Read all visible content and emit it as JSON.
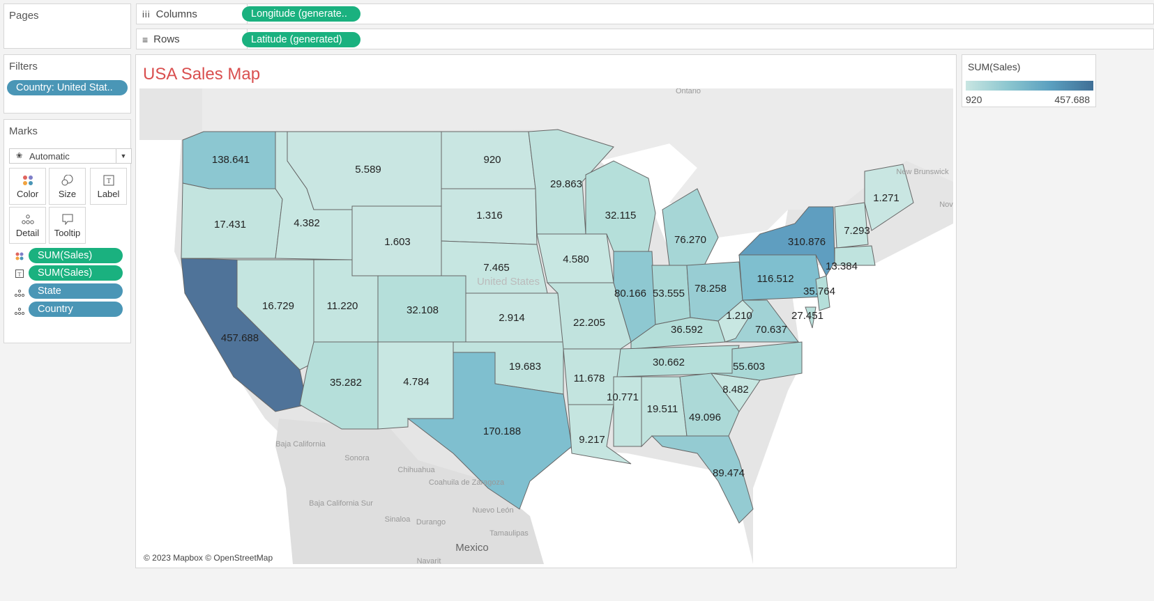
{
  "pages": {
    "title": "Pages"
  },
  "columns": {
    "label": "Columns",
    "pill": "Longitude (generate.."
  },
  "rows": {
    "label": "Rows",
    "pill": "Latitude (generated)"
  },
  "filters": {
    "title": "Filters",
    "pill": "Country: United Stat.."
  },
  "marks": {
    "title": "Marks",
    "type": "Automatic",
    "buttons": {
      "color": "Color",
      "size": "Size",
      "label": "Label",
      "detail": "Detail",
      "tooltip": "Tooltip"
    },
    "fields": [
      "SUM(Sales)",
      "SUM(Sales)",
      "State",
      "Country"
    ]
  },
  "legend": {
    "title": "SUM(Sales)",
    "min": "920",
    "max": "457.688"
  },
  "map": {
    "title": "USA Sales Map",
    "attribution": "© 2023 Mapbox © OpenStreetMap",
    "colors": {
      "low": "#c9e6e2",
      "high": "#3f6f96",
      "title": "#d94f4f",
      "pill_green": "#1ab17f",
      "pill_blue": "#4a96b6"
    },
    "states": [
      {
        "state": "California",
        "value": "457.688",
        "sales": 457688
      },
      {
        "state": "New York",
        "value": "310.876",
        "sales": 310876
      },
      {
        "state": "Texas",
        "value": "170.188",
        "sales": 170188
      },
      {
        "state": "Washington",
        "value": "138.641",
        "sales": 138641
      },
      {
        "state": "Pennsylvania",
        "value": "116.512",
        "sales": 116512
      },
      {
        "state": "Florida",
        "value": "89.474",
        "sales": 89474
      },
      {
        "state": "Illinois",
        "value": "80.166",
        "sales": 80166
      },
      {
        "state": "Ohio",
        "value": "78.258",
        "sales": 78258
      },
      {
        "state": "Michigan",
        "value": "76.270",
        "sales": 76270
      },
      {
        "state": "Virginia",
        "value": "70.637",
        "sales": 70637
      },
      {
        "state": "North Carolina",
        "value": "55.603",
        "sales": 55603
      },
      {
        "state": "Indiana",
        "value": "53.555",
        "sales": 53555
      },
      {
        "state": "Georgia",
        "value": "49.096",
        "sales": 49096
      },
      {
        "state": "Kentucky",
        "value": "36.592",
        "sales": 36592
      },
      {
        "state": "New Jersey",
        "value": "35.764",
        "sales": 35764
      },
      {
        "state": "Arizona",
        "value": "35.282",
        "sales": 35282
      },
      {
        "state": "Wisconsin",
        "value": "32.115",
        "sales": 32115
      },
      {
        "state": "Colorado",
        "value": "32.108",
        "sales": 32108
      },
      {
        "state": "Tennessee",
        "value": "30.662",
        "sales": 30662
      },
      {
        "state": "Minnesota",
        "value": "29.863",
        "sales": 29863
      },
      {
        "state": "Delaware",
        "value": "27.451",
        "sales": 27451
      },
      {
        "state": "Missouri",
        "value": "22.205",
        "sales": 22205
      },
      {
        "state": "Oklahoma",
        "value": "19.683",
        "sales": 19683
      },
      {
        "state": "Alabama",
        "value": "19.511",
        "sales": 19511
      },
      {
        "state": "Oregon",
        "value": "17.431",
        "sales": 17431
      },
      {
        "state": "Nevada",
        "value": "16.729",
        "sales": 16729
      },
      {
        "state": "Massachusetts",
        "value": "13.384",
        "sales": 13384
      },
      {
        "state": "Arkansas",
        "value": "11.678",
        "sales": 11678
      },
      {
        "state": "Utah",
        "value": "11.220",
        "sales": 11220
      },
      {
        "state": "Mississippi",
        "value": "10.771",
        "sales": 10771
      },
      {
        "state": "Louisiana",
        "value": "9.217",
        "sales": 9217
      },
      {
        "state": "South Carolina",
        "value": "8.482",
        "sales": 8482
      },
      {
        "state": "Kansas",
        "value": "2.914",
        "sales": 2914
      },
      {
        "state": "Nebraska",
        "value": "7.465",
        "sales": 7465
      },
      {
        "state": "New Hampshire",
        "value": "7.293",
        "sales": 7293
      },
      {
        "state": "Montana",
        "value": "5.589",
        "sales": 5589
      },
      {
        "state": "New Mexico",
        "value": "4.784",
        "sales": 4784
      },
      {
        "state": "Iowa",
        "value": "4.580",
        "sales": 4580
      },
      {
        "state": "Idaho",
        "value": "4.382",
        "sales": 4382
      },
      {
        "state": "Wyoming",
        "value": "1.603",
        "sales": 1603
      },
      {
        "state": "South Dakota",
        "value": "1.316",
        "sales": 1316
      },
      {
        "state": "Maine",
        "value": "1.271",
        "sales": 1271
      },
      {
        "state": "West Virginia",
        "value": "1.210",
        "sales": 1210
      },
      {
        "state": "North Dakota",
        "value": "920",
        "sales": 920
      }
    ],
    "places": [
      "Ontario",
      "New Brunswick",
      "United States",
      "Baja California",
      "Sonora",
      "Chihuahua",
      "Coahuila de Zaragoza",
      "Baja California Sur",
      "Sinaloa",
      "Durango",
      "Nuevo León",
      "Tamaulipas",
      "Mexico",
      "Navarit",
      "Nov"
    ]
  }
}
